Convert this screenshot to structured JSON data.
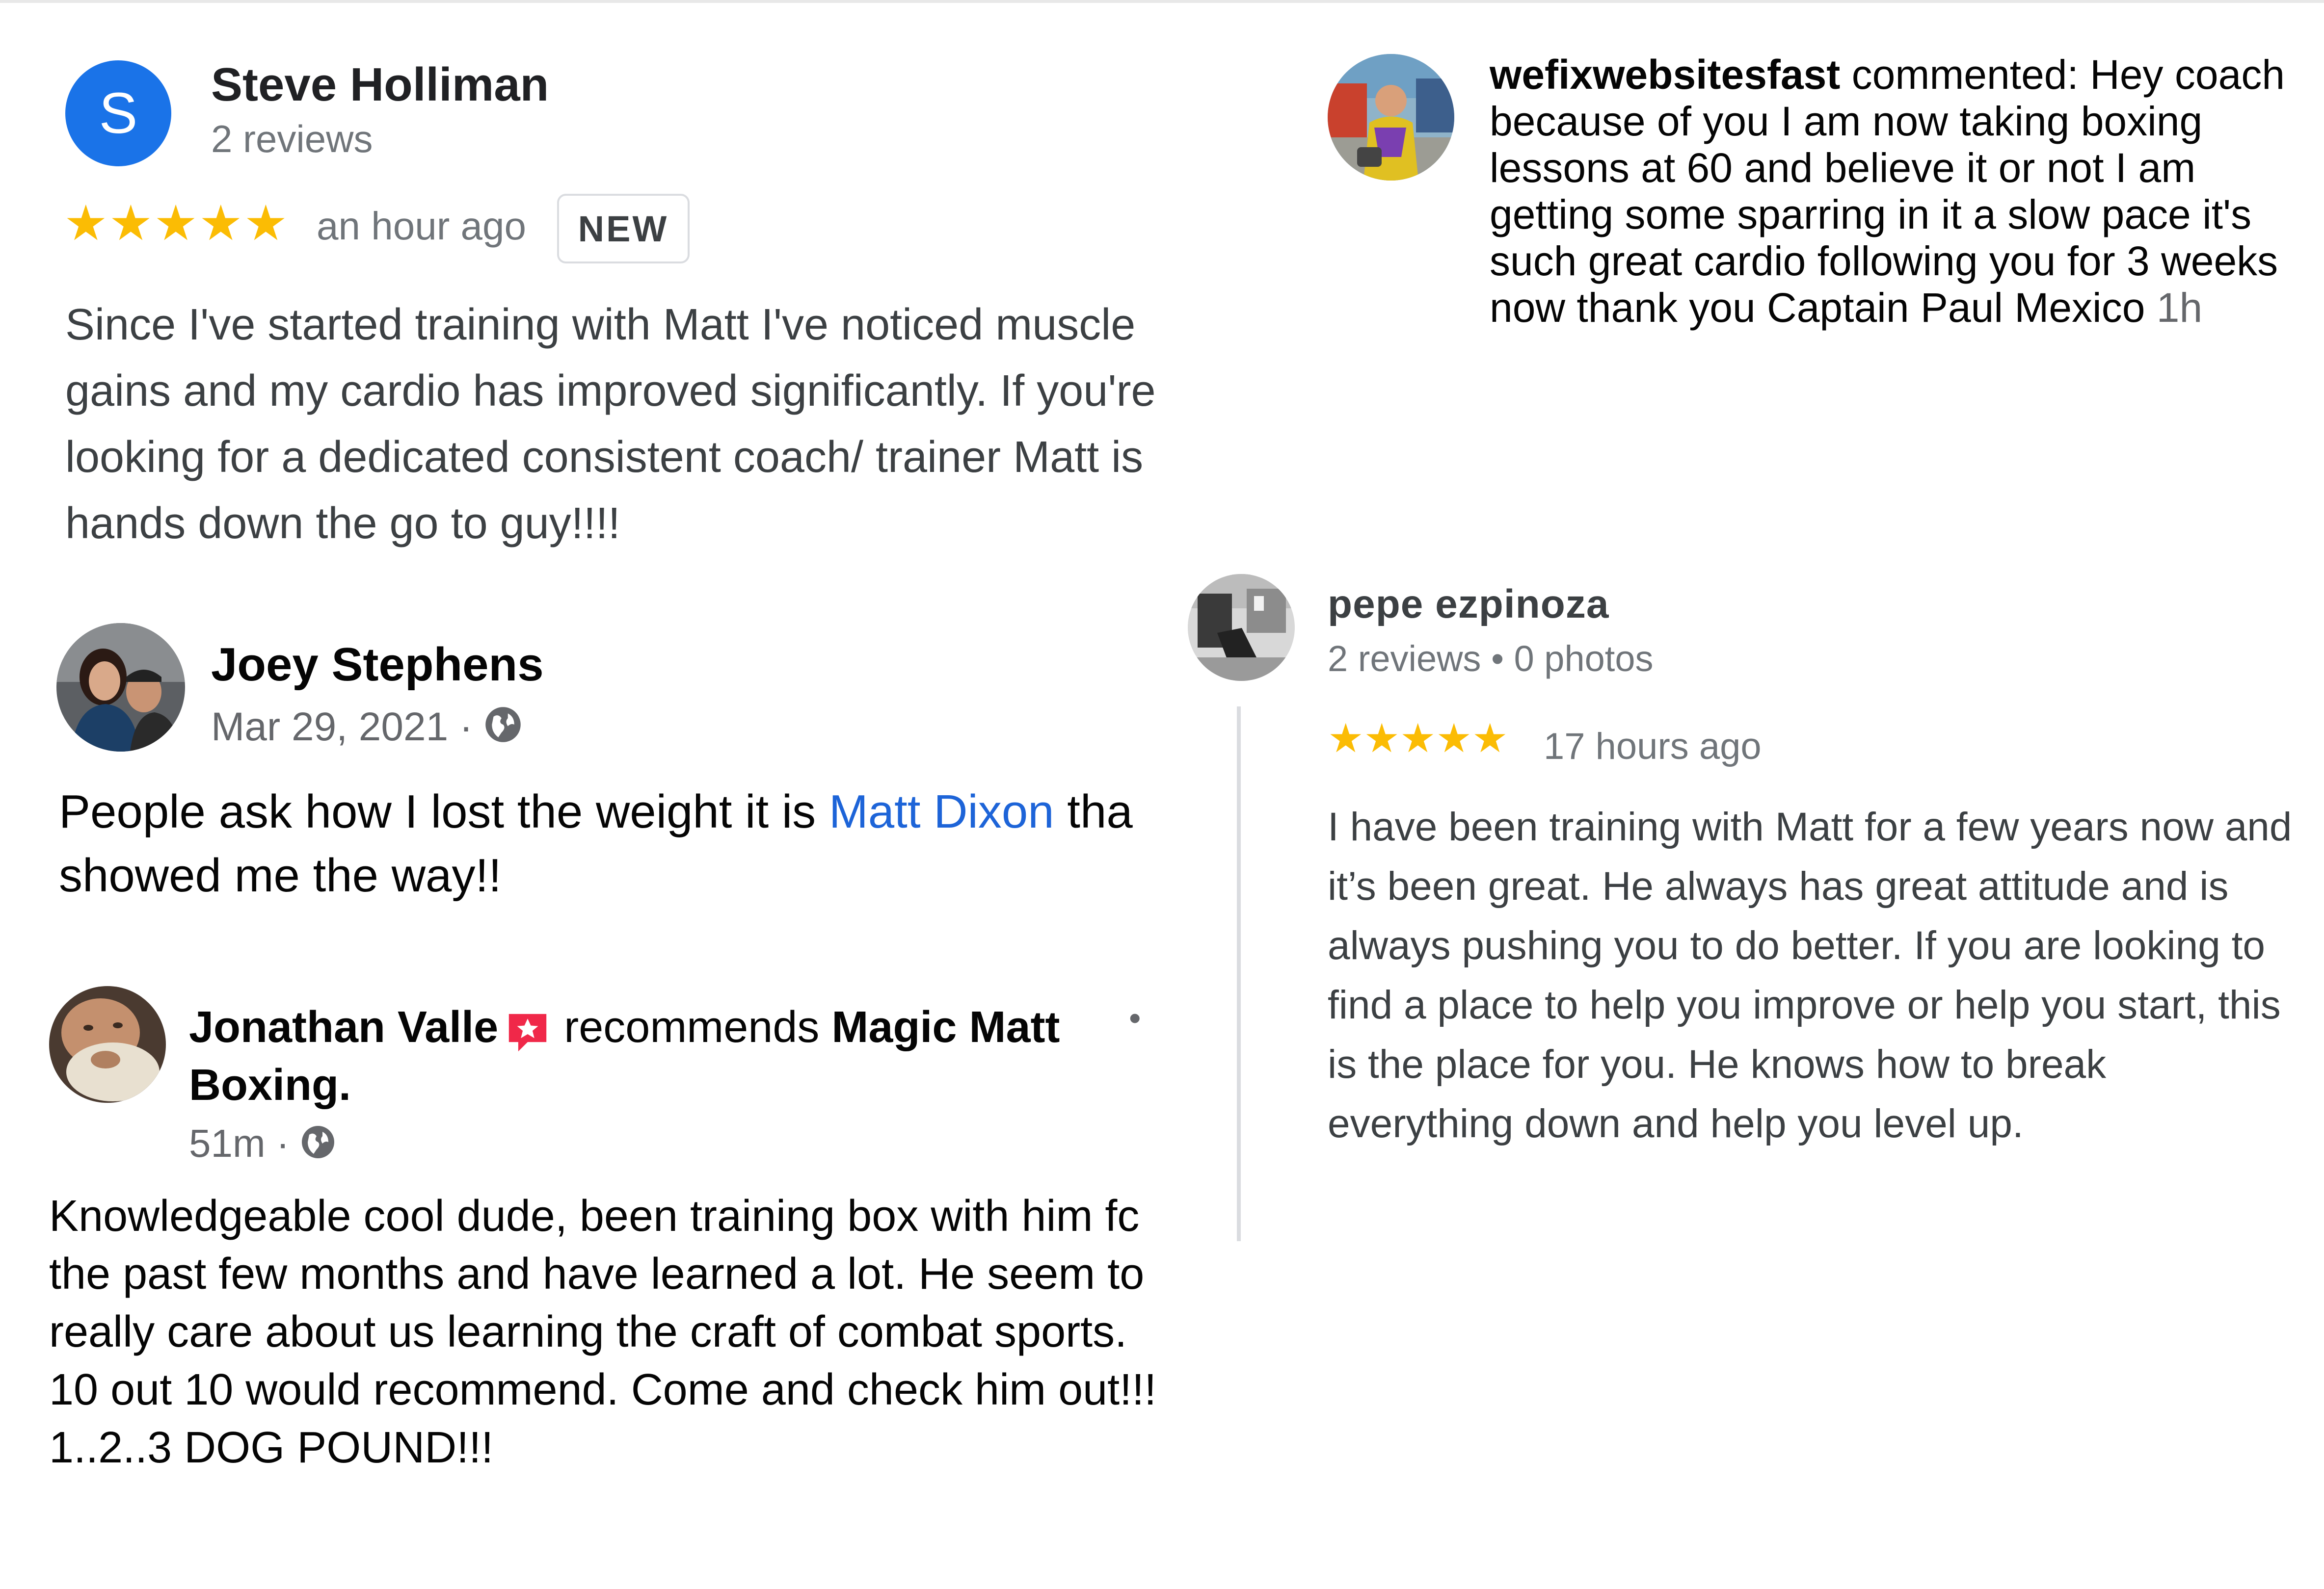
{
  "reviews": {
    "steve": {
      "avatar_letter": "S",
      "name": "Steve Holliman",
      "reviews": "2 reviews",
      "stars": "★★★★★",
      "rating": 5,
      "time": "an hour ago",
      "badge": "NEW",
      "text": "Since I've started training with Matt I've noticed muscle gains and my cardio has improved significantly. If you're looking for a dedicated consistent coach/ trainer Matt is hands down the go to guy!!!!"
    },
    "wefix": {
      "user": "wefixwebsitesfast",
      "text": " commented: Hey coach because of you I am now taking boxing lessons at 60 and believe it or not I am getting some sparring in it a slow pace it's such great cardio following you for 3 weeks now thank you Captain Paul Mexico ",
      "time": "1h"
    },
    "joey": {
      "name": "Joey Stephens",
      "date": "Mar 29, 2021 · ",
      "text_before": "People ask how I lost the weight it is ",
      "link": "Matt Dixon",
      "text_after": " tha",
      "text_line2": "showed me the way!!"
    },
    "jonathan": {
      "name": "Jonathan Valle",
      "recommends": "recommends ",
      "page": "Magic Matt Boxing.",
      "dot": "•",
      "time": "51m · ",
      "lines": [
        "Knowledgeable cool dude, been training box with him fc",
        "the past few months and have learned a lot. He seem to",
        "really care about us learning the craft of combat sports.",
        "10 out 10 would recommend. Come and check him out!!!",
        "1..2..3 DOG POUND!!!"
      ]
    },
    "pepe": {
      "name": "pepe ezpinoza",
      "meta": "2 reviews • 0 photos",
      "stars": "★★★★★",
      "rating": 5,
      "time": "17 hours ago",
      "text": "I have been training with Matt for a few years now and it’s been great. He always has great attitude and is always pushing you to do better. If you are looking to find a place to help you improve or help you start, this is the place for you. He knows how to break everything down and help you level up."
    }
  },
  "colors": {
    "google_blue": "#1a73e8",
    "star_yellow": "#fbbc04",
    "link_blue": "#1d64d8"
  },
  "icons": [
    "globe-icon",
    "recommend-icon",
    "avatar-photo"
  ]
}
